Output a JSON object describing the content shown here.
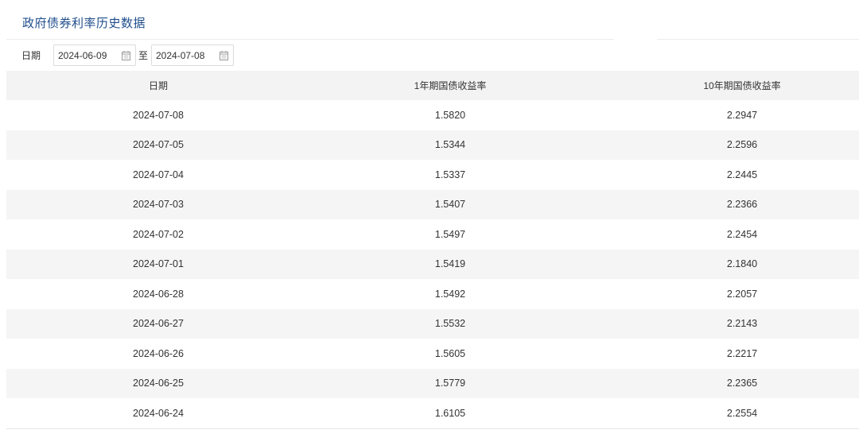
{
  "page": {
    "title": "政府债券利率历史数据"
  },
  "filter": {
    "label": "日期",
    "start_date": "2024-06-09",
    "separator": "至",
    "end_date": "2024-07-08",
    "calendar_icon": "calendar-icon"
  },
  "table": {
    "headers": [
      "日期",
      "1年期国债收益率",
      "10年期国债收益率"
    ],
    "rows": [
      [
        "2024-07-08",
        "1.5820",
        "2.2947"
      ],
      [
        "2024-07-05",
        "1.5344",
        "2.2596"
      ],
      [
        "2024-07-04",
        "1.5337",
        "2.2445"
      ],
      [
        "2024-07-03",
        "1.5407",
        "2.2366"
      ],
      [
        "2024-07-02",
        "1.5497",
        "2.2454"
      ],
      [
        "2024-07-01",
        "1.5419",
        "2.1840"
      ],
      [
        "2024-06-28",
        "1.5492",
        "2.2057"
      ],
      [
        "2024-06-27",
        "1.5532",
        "2.2143"
      ],
      [
        "2024-06-26",
        "1.5605",
        "2.2217"
      ],
      [
        "2024-06-25",
        "1.5779",
        "2.2365"
      ],
      [
        "2024-06-24",
        "1.6105",
        "2.2554"
      ]
    ]
  },
  "colors": {
    "title": "#1f4e8c",
    "stripe": "#f5f5f5",
    "header_bg": "#f3f3f3",
    "text": "#333333"
  }
}
